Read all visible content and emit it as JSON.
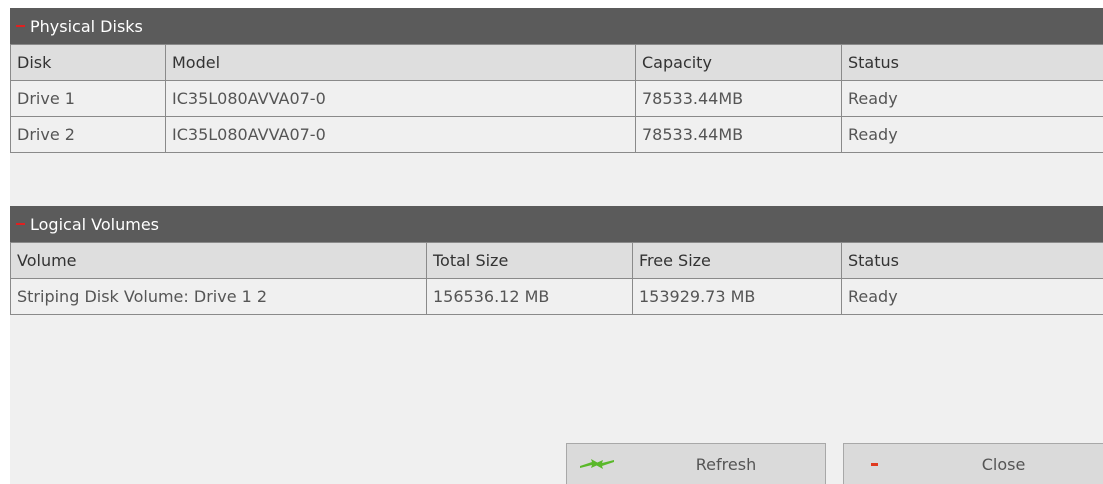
{
  "physical_disks": {
    "title": "Physical Disks",
    "columns": [
      "Disk",
      "Model",
      "Capacity",
      "Status"
    ],
    "rows": [
      [
        "Drive 1",
        "IC35L080AVVA07-0",
        "78533.44MB",
        "Ready"
      ],
      [
        "Drive 2",
        "IC35L080AVVA07-0",
        "78533.44MB",
        "Ready"
      ]
    ]
  },
  "logical_volumes": {
    "title": "Logical Volumes",
    "columns": [
      "Volume",
      "Total Size",
      "Free Size",
      "Status"
    ],
    "rows": [
      [
        "Striping Disk Volume: Drive 1 2",
        "156536.12 MB",
        "153929.73 MB",
        "Ready"
      ]
    ]
  },
  "buttons": {
    "refresh": "Refresh",
    "close": "Close"
  },
  "colors": {
    "header_bg": "#5b5b5b",
    "collapse_accent": "#e02020",
    "refresh_arrow": "#5ab82a"
  },
  "icons": {
    "collapse": "minus-icon",
    "refresh": "refresh-arrows-icon",
    "close": "minus-icon"
  }
}
